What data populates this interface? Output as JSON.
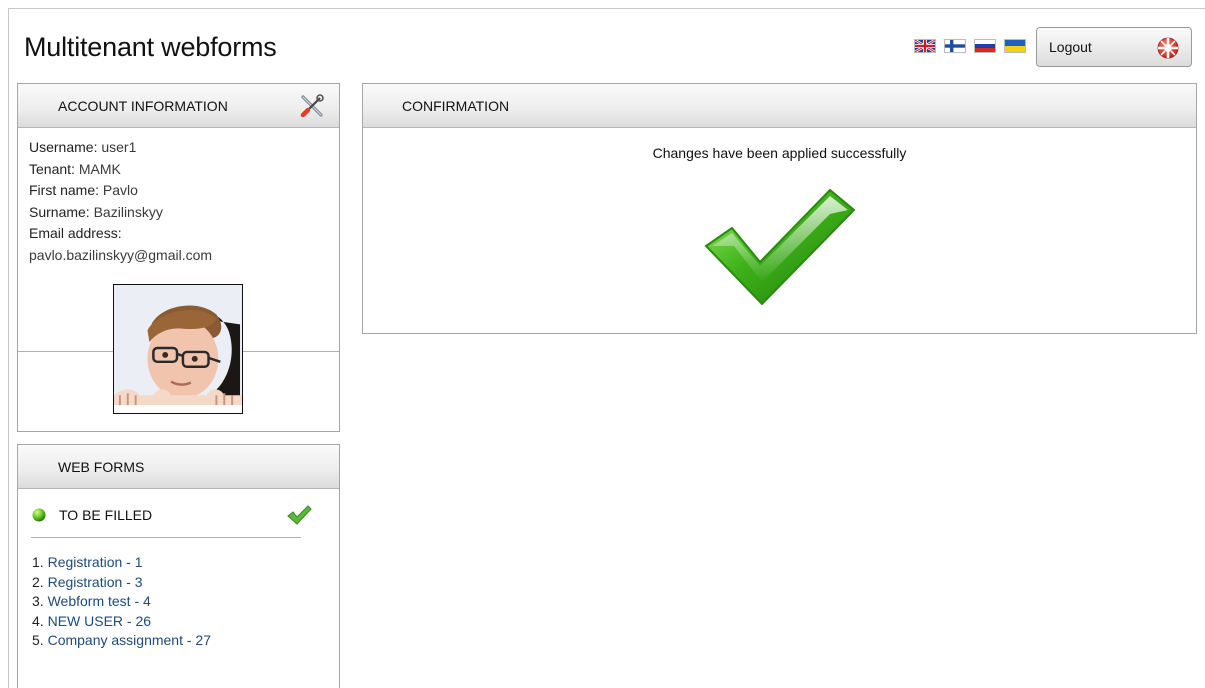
{
  "header": {
    "title": "Multitenant webforms"
  },
  "languages": [
    {
      "code": "en",
      "icon": "uk-flag-icon"
    },
    {
      "code": "fi",
      "icon": "finland-flag-icon"
    },
    {
      "code": "ru",
      "icon": "russia-flag-icon"
    },
    {
      "code": "uk",
      "icon": "ukraine-flag-icon"
    }
  ],
  "logout": {
    "label": "Logout",
    "icon": "lifebuoy-icon"
  },
  "account": {
    "title": "ACCOUNT INFORMATION",
    "icon": "tools-icon",
    "username_label": "Username:",
    "username_value": "user1",
    "tenant_label": "Tenant:",
    "tenant_value": "MAMK",
    "firstname_label": "First name:",
    "firstname_value": "Pavlo",
    "surname_label": "Surname:",
    "surname_value": "Bazilinskyy",
    "email_label": "Email address:",
    "email_value": "pavlo.bazilinskyy@gmail.com"
  },
  "webforms": {
    "title": "WEB FORMS",
    "status_label": "TO BE FILLED",
    "items": [
      {
        "num": "1.",
        "label": "Registration - 1"
      },
      {
        "num": "2.",
        "label": "Registration - 3"
      },
      {
        "num": "3.",
        "label": "Webform test - 4"
      },
      {
        "num": "4.",
        "label": "NEW USER - 26"
      },
      {
        "num": "5.",
        "label": "Company assignment - 27"
      }
    ]
  },
  "confirmation": {
    "title": "CONFIRMATION",
    "message": "Changes have been applied successfully"
  },
  "colors": {
    "link": "#1f4a7a",
    "success_green": "#3fb21a",
    "panel_border": "#a6a6a6"
  }
}
